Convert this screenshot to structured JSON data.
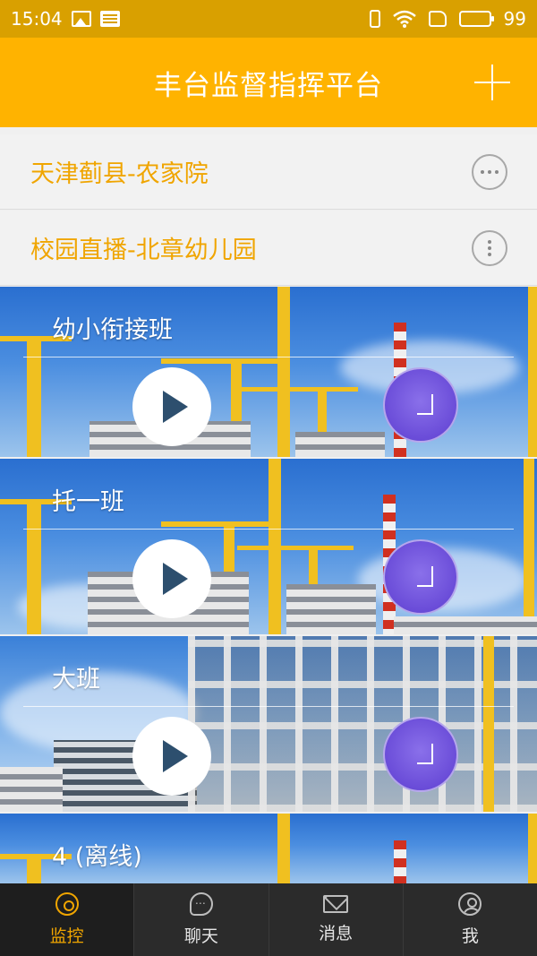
{
  "status_bar": {
    "time": "15:04",
    "battery": "99",
    "icons": [
      "image-icon",
      "news-icon",
      "vibrate-icon",
      "wifi-icon",
      "sim-icon",
      "battery-icon"
    ]
  },
  "header": {
    "title": "丰台监督指挥平台",
    "add_icon": "plus-icon"
  },
  "groups": [
    {
      "label": "天津蓟县-农家院",
      "menu_icon": "more-horizontal-icon"
    },
    {
      "label": "校园直播-北章幼儿园",
      "menu_icon": "more-vertical-icon"
    }
  ],
  "cameras": [
    {
      "title": "幼小衔接班"
    },
    {
      "title": "托一班"
    },
    {
      "title": "大班"
    },
    {
      "title": "4 (离线)"
    }
  ],
  "bottom_nav": {
    "items": [
      {
        "label": "监控",
        "icon": "camera-icon",
        "active": true
      },
      {
        "label": "聊天",
        "icon": "chat-icon",
        "active": false
      },
      {
        "label": "消息",
        "icon": "mail-icon",
        "active": false
      },
      {
        "label": "我",
        "icon": "user-icon",
        "active": false
      }
    ]
  },
  "colors": {
    "accent": "#ffb300",
    "status_bar": "#d9a000",
    "group_text": "#f0a500",
    "nav_bg": "#2b2b2b"
  }
}
